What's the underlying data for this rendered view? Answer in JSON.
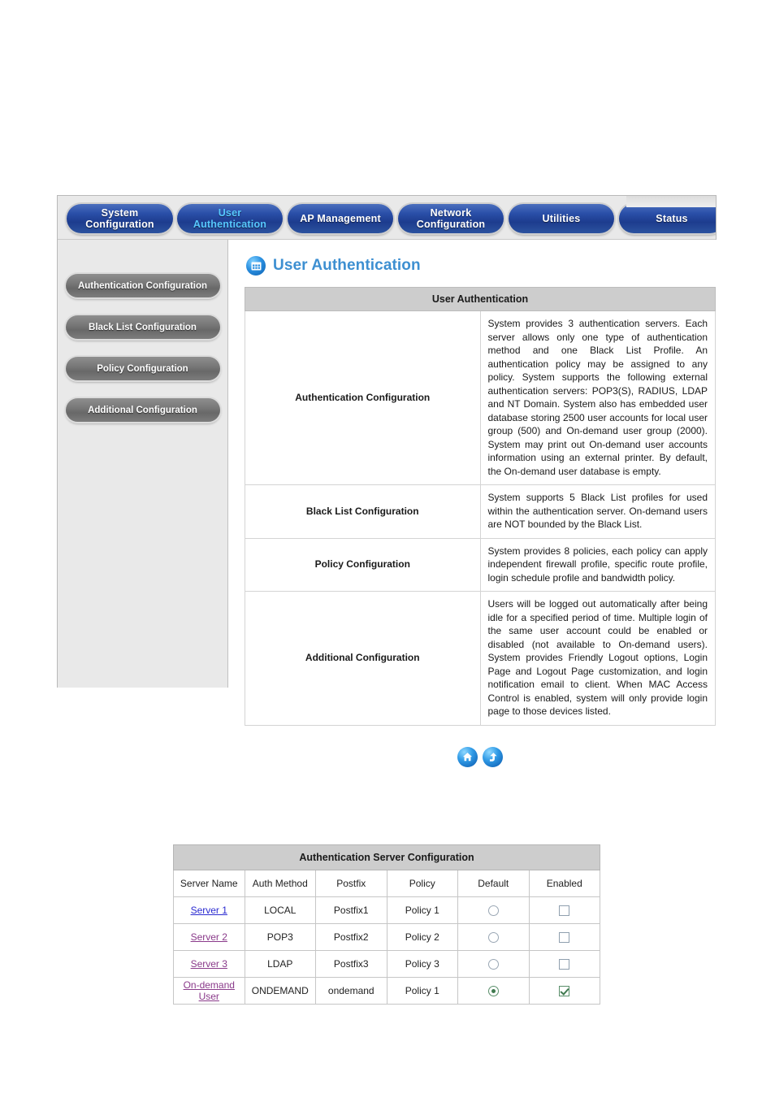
{
  "nav": {
    "tabs": [
      {
        "label": "System Configuration",
        "active": false
      },
      {
        "label": "User Authentication",
        "active": true
      },
      {
        "label": "AP Management",
        "active": false
      },
      {
        "label": "Network Configuration",
        "active": false
      },
      {
        "label": "Utilities",
        "active": false
      },
      {
        "label": "Status",
        "active": false
      }
    ]
  },
  "sidebar": {
    "items": [
      {
        "label": "Authentication Configuration"
      },
      {
        "label": "Black List Configuration"
      },
      {
        "label": "Policy Configuration"
      },
      {
        "label": "Additional Configuration"
      }
    ]
  },
  "page": {
    "title": "User Authentication",
    "title_icon": "grid-window-icon"
  },
  "info_table": {
    "caption": "User Authentication",
    "rows": [
      {
        "label": "Authentication Configuration",
        "description": "System provides 3 authentication servers. Each server allows only one type of authentication method and one Black List Profile. An authentication policy may be assigned to any policy. System supports the following external authentication servers: POP3(S), RADIUS, LDAP and NT Domain.\nSystem also has embedded user database storing 2500 user accounts for local user group (500) and On-demand user group (2000). System may print out On-demand user accounts information using an external printer. By default, the On-demand user database is empty."
      },
      {
        "label": "Black List Configuration",
        "description": "System supports 5 Black List profiles for used within the authentication server. On-demand users are NOT bounded by the Black List."
      },
      {
        "label": "Policy Configuration",
        "description": "System provides 8 policies, each policy can apply independent firewall profile, specific route profile, login schedule profile and bandwidth policy."
      },
      {
        "label": "Additional Configuration",
        "description": "Users will be logged out automatically after being idle for a specified period of time. Multiple login of the same user account could be enabled or disabled (not available to On-demand users). System provides Friendly Logout options, Login Page and Logout Page customization, and login notification email to client.\nWhen MAC Access Control is enabled, system will only provide login page to those devices listed."
      }
    ]
  },
  "footer": {
    "icons": [
      {
        "name": "home-icon",
        "title": "Home"
      },
      {
        "name": "back-to-top-icon",
        "title": "Top"
      }
    ]
  },
  "server_table": {
    "caption": "Authentication Server Configuration",
    "columns": [
      "Server Name",
      "Auth Method",
      "Postfix",
      "Policy",
      "Default",
      "Enabled"
    ],
    "rows": [
      {
        "name": "Server 1",
        "visited": false,
        "auth_method": "LOCAL",
        "postfix": "Postfix1",
        "policy": "Policy 1",
        "default": false,
        "enabled": false
      },
      {
        "name": "Server 2",
        "visited": true,
        "auth_method": "POP3",
        "postfix": "Postfix2",
        "policy": "Policy 2",
        "default": false,
        "enabled": false
      },
      {
        "name": "Server 3",
        "visited": true,
        "auth_method": "LDAP",
        "postfix": "Postfix3",
        "policy": "Policy 3",
        "default": false,
        "enabled": false
      },
      {
        "name": "On-demand User",
        "visited": true,
        "auth_method": "ONDEMAND",
        "postfix": "ondemand",
        "policy": "Policy 1",
        "default": true,
        "enabled": true
      }
    ]
  },
  "colors": {
    "tab_blue": "#2a4fa8",
    "tab_active_text": "#57c8ff",
    "title_blue": "#3d8fd1",
    "sidebar_gray": "#e9e9e9",
    "table_header_gray": "#cdcdcd",
    "link_blue": "#2a2ad0",
    "link_visited": "#8a3a8a",
    "check_green": "#3f7a4f"
  }
}
